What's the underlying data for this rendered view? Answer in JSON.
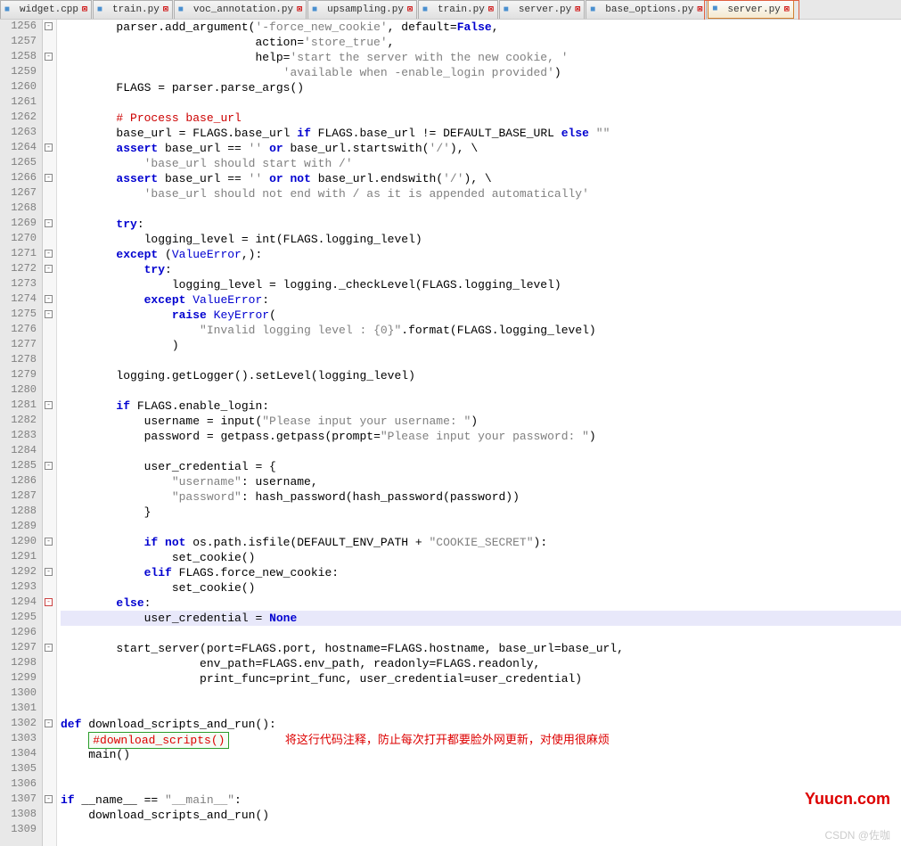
{
  "tabs": [
    {
      "label": "widget.cpp",
      "icon": "■",
      "iconColor": "#4a90d0"
    },
    {
      "label": "train.py",
      "icon": "■",
      "iconColor": "#4a90d0"
    },
    {
      "label": "voc_annotation.py",
      "icon": "■",
      "iconColor": "#4a90d0"
    },
    {
      "label": "upsampling.py",
      "icon": "■",
      "iconColor": "#4a90d0"
    },
    {
      "label": "train.py",
      "icon": "■",
      "iconColor": "#4a90d0"
    },
    {
      "label": "server.py",
      "icon": "■",
      "iconColor": "#4a90d0"
    },
    {
      "label": "base_options.py",
      "icon": "■",
      "iconColor": "#4a90d0"
    },
    {
      "label": "server.py",
      "icon": "■",
      "iconColor": "#4a90d0",
      "active": true
    }
  ],
  "startLine": 1256,
  "endLine": 1309,
  "code": {
    "l1256": {
      "indent": 2,
      "tokens": [
        [
          "",
          "parser.add_argument("
        ],
        [
          "str",
          "'-force_new_cookie'"
        ],
        [
          "",
          ", default="
        ],
        [
          "kw",
          "False"
        ],
        [
          "",
          ","
        ]
      ]
    },
    "l1257": {
      "indent": 7,
      "tokens": [
        [
          "",
          "action="
        ],
        [
          "str",
          "'store_true'"
        ],
        [
          "",
          ","
        ]
      ]
    },
    "l1258": {
      "indent": 7,
      "tokens": [
        [
          "",
          "help="
        ],
        [
          "str",
          "'start the server with the new cookie, '"
        ]
      ]
    },
    "l1259": {
      "indent": 8,
      "tokens": [
        [
          "str",
          "'available when -enable_login provided'"
        ],
        [
          "",
          ")"
        ]
      ]
    },
    "l1260": {
      "indent": 2,
      "tokens": [
        [
          "",
          "FLAGS = parser.parse_args()"
        ]
      ]
    },
    "l1261": {
      "indent": 0,
      "tokens": []
    },
    "l1262": {
      "indent": 2,
      "tokens": [
        [
          "comment",
          "# Process base_url"
        ]
      ]
    },
    "l1263": {
      "indent": 2,
      "tokens": [
        [
          "",
          "base_url = FLAGS.base_url "
        ],
        [
          "kw",
          "if"
        ],
        [
          "",
          " FLAGS.base_url != DEFAULT_BASE_URL "
        ],
        [
          "kw",
          "else"
        ],
        [
          "",
          " "
        ],
        [
          "str",
          "\"\""
        ]
      ]
    },
    "l1264": {
      "indent": 2,
      "tokens": [
        [
          "kw",
          "assert"
        ],
        [
          "",
          " base_url == "
        ],
        [
          "str",
          "''"
        ],
        [
          "",
          " "
        ],
        [
          "kw",
          "or"
        ],
        [
          "",
          " base_url.startswith("
        ],
        [
          "str",
          "'/'"
        ],
        [
          "",
          "), \\"
        ]
      ]
    },
    "l1265": {
      "indent": 3,
      "tokens": [
        [
          "str",
          "'base_url should start with /'"
        ]
      ]
    },
    "l1266": {
      "indent": 2,
      "tokens": [
        [
          "kw",
          "assert"
        ],
        [
          "",
          " base_url == "
        ],
        [
          "str",
          "''"
        ],
        [
          "",
          " "
        ],
        [
          "kw",
          "or not"
        ],
        [
          "",
          " base_url.endswith("
        ],
        [
          "str",
          "'/'"
        ],
        [
          "",
          "), \\"
        ]
      ]
    },
    "l1267": {
      "indent": 3,
      "tokens": [
        [
          "str",
          "'base_url should not end with / as it is appended automatically'"
        ]
      ]
    },
    "l1268": {
      "indent": 0,
      "tokens": []
    },
    "l1269": {
      "indent": 2,
      "tokens": [
        [
          "kw",
          "try"
        ],
        [
          "",
          ":"
        ]
      ]
    },
    "l1270": {
      "indent": 3,
      "tokens": [
        [
          "",
          "logging_level = int(FLAGS.logging_level)"
        ]
      ]
    },
    "l1271": {
      "indent": 2,
      "tokens": [
        [
          "kw",
          "except"
        ],
        [
          "",
          " ("
        ],
        [
          "kw2",
          "ValueError"
        ],
        [
          "",
          ",):"
        ]
      ]
    },
    "l1272": {
      "indent": 3,
      "tokens": [
        [
          "kw",
          "try"
        ],
        [
          "",
          ":"
        ]
      ]
    },
    "l1273": {
      "indent": 4,
      "tokens": [
        [
          "",
          "logging_level = logging._checkLevel(FLAGS.logging_level)"
        ]
      ]
    },
    "l1274": {
      "indent": 3,
      "tokens": [
        [
          "kw",
          "except"
        ],
        [
          "",
          " "
        ],
        [
          "kw2",
          "ValueError"
        ],
        [
          "",
          ":"
        ]
      ]
    },
    "l1275": {
      "indent": 4,
      "tokens": [
        [
          "kw",
          "raise"
        ],
        [
          "",
          " "
        ],
        [
          "kw2",
          "KeyError"
        ],
        [
          "",
          "("
        ]
      ]
    },
    "l1276": {
      "indent": 5,
      "tokens": [
        [
          "str",
          "\"Invalid logging level : {0}\""
        ],
        [
          "",
          ".format(FLAGS.logging_level)"
        ]
      ]
    },
    "l1277": {
      "indent": 4,
      "tokens": [
        [
          "",
          ")"
        ]
      ]
    },
    "l1278": {
      "indent": 0,
      "tokens": []
    },
    "l1279": {
      "indent": 2,
      "tokens": [
        [
          "",
          "logging.getLogger().setLevel(logging_level)"
        ]
      ]
    },
    "l1280": {
      "indent": 0,
      "tokens": []
    },
    "l1281": {
      "indent": 2,
      "tokens": [
        [
          "kw",
          "if"
        ],
        [
          "",
          " FLAGS.enable_login:"
        ]
      ]
    },
    "l1282": {
      "indent": 3,
      "tokens": [
        [
          "",
          "username = input("
        ],
        [
          "str",
          "\"Please input your username: \""
        ],
        [
          "",
          ")"
        ]
      ]
    },
    "l1283": {
      "indent": 3,
      "tokens": [
        [
          "",
          "password = getpass.getpass(prompt="
        ],
        [
          "str",
          "\"Please input your password: \""
        ],
        [
          "",
          ")"
        ]
      ]
    },
    "l1284": {
      "indent": 0,
      "tokens": []
    },
    "l1285": {
      "indent": 3,
      "tokens": [
        [
          "",
          "user_credential = {"
        ]
      ]
    },
    "l1286": {
      "indent": 4,
      "tokens": [
        [
          "str",
          "\"username\""
        ],
        [
          "",
          ": username,"
        ]
      ]
    },
    "l1287": {
      "indent": 4,
      "tokens": [
        [
          "str",
          "\"password\""
        ],
        [
          "",
          ": hash_password(hash_password(password))"
        ]
      ]
    },
    "l1288": {
      "indent": 3,
      "tokens": [
        [
          "",
          "}"
        ]
      ]
    },
    "l1289": {
      "indent": 0,
      "tokens": []
    },
    "l1290": {
      "indent": 3,
      "tokens": [
        [
          "kw",
          "if not"
        ],
        [
          "",
          " os.path.isfile(DEFAULT_ENV_PATH + "
        ],
        [
          "str",
          "\"COOKIE_SECRET\""
        ],
        [
          "",
          "):"
        ]
      ]
    },
    "l1291": {
      "indent": 4,
      "tokens": [
        [
          "",
          "set_cookie()"
        ]
      ]
    },
    "l1292": {
      "indent": 3,
      "tokens": [
        [
          "kw",
          "elif"
        ],
        [
          "",
          " FLAGS.force_new_cookie:"
        ]
      ]
    },
    "l1293": {
      "indent": 4,
      "tokens": [
        [
          "",
          "set_cookie()"
        ]
      ]
    },
    "l1294": {
      "indent": 2,
      "tokens": [
        [
          "kw",
          "else"
        ],
        [
          "",
          ":"
        ]
      ]
    },
    "l1295": {
      "indent": 3,
      "tokens": [
        [
          "",
          "user_credential = "
        ],
        [
          "kw",
          "None"
        ]
      ],
      "hl": true
    },
    "l1296": {
      "indent": 0,
      "tokens": []
    },
    "l1297": {
      "indent": 2,
      "tokens": [
        [
          "",
          "start_server(port=FLAGS.port, hostname=FLAGS.hostname, base_url=base_url,"
        ]
      ]
    },
    "l1298": {
      "indent": 5,
      "tokens": [
        [
          "",
          "env_path=FLAGS.env_path, readonly=FLAGS.readonly,"
        ]
      ]
    },
    "l1299": {
      "indent": 5,
      "tokens": [
        [
          "",
          "print_func=print_func, user_credential=user_credential)"
        ]
      ]
    },
    "l1300": {
      "indent": 0,
      "tokens": []
    },
    "l1301": {
      "indent": 0,
      "tokens": []
    },
    "l1302": {
      "indent": 0,
      "tokens": [
        [
          "kw",
          "def"
        ],
        [
          "",
          " download_scripts_and_run():"
        ]
      ]
    },
    "l1303": {
      "indent": 1,
      "green": "#download_scripts()",
      "anno": "将这行代码注释，防止每次打开都要脸外网更新，对使用很麻烦"
    },
    "l1304": {
      "indent": 1,
      "tokens": [
        [
          "",
          "main()"
        ]
      ]
    },
    "l1305": {
      "indent": 0,
      "tokens": []
    },
    "l1306": {
      "indent": 0,
      "tokens": []
    },
    "l1307": {
      "indent": 0,
      "tokens": [
        [
          "kw",
          "if"
        ],
        [
          "",
          " __name__ == "
        ],
        [
          "str",
          "\"__main__\""
        ],
        [
          "",
          ":"
        ]
      ]
    },
    "l1308": {
      "indent": 1,
      "tokens": [
        [
          "",
          "download_scripts_and_run()"
        ]
      ]
    },
    "l1309": {
      "indent": 0,
      "tokens": []
    }
  },
  "folds": {
    "1256": "-",
    "1258": "-",
    "1264": "-",
    "1266": "-",
    "1269": "-",
    "1271": "-",
    "1272": "-",
    "1274": "-",
    "1275": "-",
    "1281": "-",
    "1285": "-",
    "1290": "-",
    "1292": "-",
    "1294": "-r",
    "1297": "-",
    "1302": "-",
    "1307": "-"
  },
  "watermark1": "Yuucn.com",
  "watermark2": "CSDN @佐咖"
}
